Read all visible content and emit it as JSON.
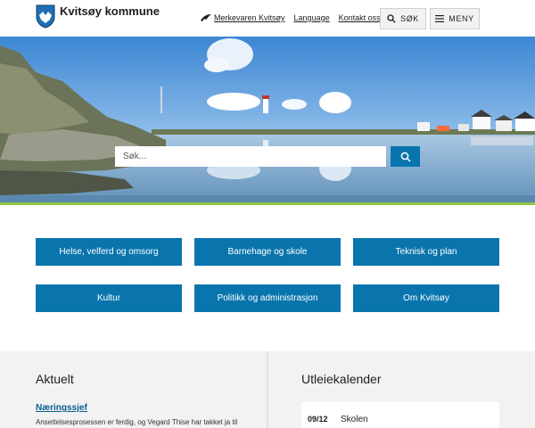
{
  "header": {
    "logo_text": "Kvitsøy kommune",
    "links": [
      {
        "label": "Merkevaren Kvitsøy"
      },
      {
        "label": "Language"
      },
      {
        "label": "Kontakt oss"
      }
    ],
    "search_button": "SØK",
    "menu_button": "MENY"
  },
  "hero": {
    "search_placeholder": "Søk..."
  },
  "categories": [
    {
      "label": "Helse, velferd og omsorg"
    },
    {
      "label": "Barnehage og skole"
    },
    {
      "label": "Teknisk og plan"
    },
    {
      "label": "Kultur"
    },
    {
      "label": "Politikk og administrasjon"
    },
    {
      "label": "Om Kvitsøy"
    }
  ],
  "news": {
    "title": "Aktuelt",
    "items": [
      {
        "headline": "Næringssjef",
        "summary": "Ansettelsesprosessen er ferdig, og Vegard Thise har takket ja til"
      }
    ]
  },
  "calendar": {
    "title": "Utleiekalender",
    "items": [
      {
        "date": "09/12",
        "label": "Skolen"
      }
    ]
  },
  "colors": {
    "primary": "#0a75ad",
    "accent_green": "#8dc63f",
    "section_bg": "#f2f2f2"
  }
}
